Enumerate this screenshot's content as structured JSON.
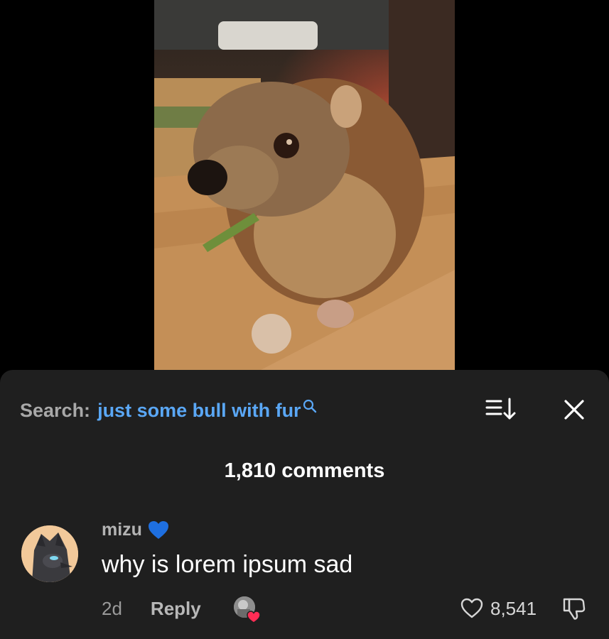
{
  "video": {
    "content": "video-frame"
  },
  "search": {
    "label": "Search:",
    "query": "just some bull with fur"
  },
  "header": {
    "comment_count": "1,810 comments"
  },
  "comments": [
    {
      "username": "mizu",
      "badge_icon": "blue-heart",
      "text": "why is lorem ipsum sad",
      "age": "2d",
      "reply_label": "Reply",
      "likes": "8,541"
    }
  ],
  "colors": {
    "sheet_bg": "#1f1f1f",
    "query_blue": "#5aa7f5",
    "heart_blue": "#1e6fe0",
    "creator_heart": "#ff2d55"
  }
}
